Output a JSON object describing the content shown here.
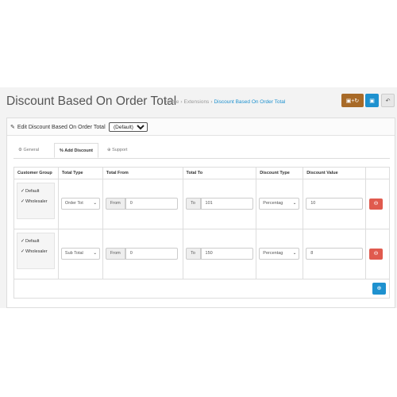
{
  "header": {
    "title": "Discount Based On Order Total",
    "breadcrumb": [
      "Home",
      "Extensions",
      "Discount Based On Order Total"
    ],
    "buttons": {
      "save_close_icon": "save-and-close-icon",
      "save_icon": "save-icon",
      "back_icon": "back-icon"
    }
  },
  "panel": {
    "title": "Edit Discount Based On Order Total",
    "store_select": "(Default)"
  },
  "tabs": [
    {
      "label": "General",
      "icon": "gear-icon"
    },
    {
      "label": "Add Discount",
      "icon": "percent-icon"
    },
    {
      "label": "Support",
      "icon": "lifebuoy-icon"
    }
  ],
  "table": {
    "headers": [
      "Customer Group",
      "Total Type",
      "Total From",
      "Total To",
      "Discount Type",
      "Discount Value"
    ],
    "rows": [
      {
        "groups": [
          "Default",
          "Wholesaler"
        ],
        "total_type": "Order Tot",
        "from_label": "From",
        "from_value": "0",
        "to_label": "To",
        "to_value": "101",
        "discount_type": "Percentag",
        "discount_value": "10"
      },
      {
        "groups": [
          "Default",
          "Wholesaler"
        ],
        "total_type": "Sub Total",
        "from_label": "From",
        "from_value": "0",
        "to_label": "To",
        "to_value": "150",
        "discount_type": "Percentag",
        "discount_value": "8"
      }
    ]
  },
  "colors": {
    "primary": "#1e91cf",
    "danger": "#e05a4e",
    "warning": "#a86a28"
  }
}
